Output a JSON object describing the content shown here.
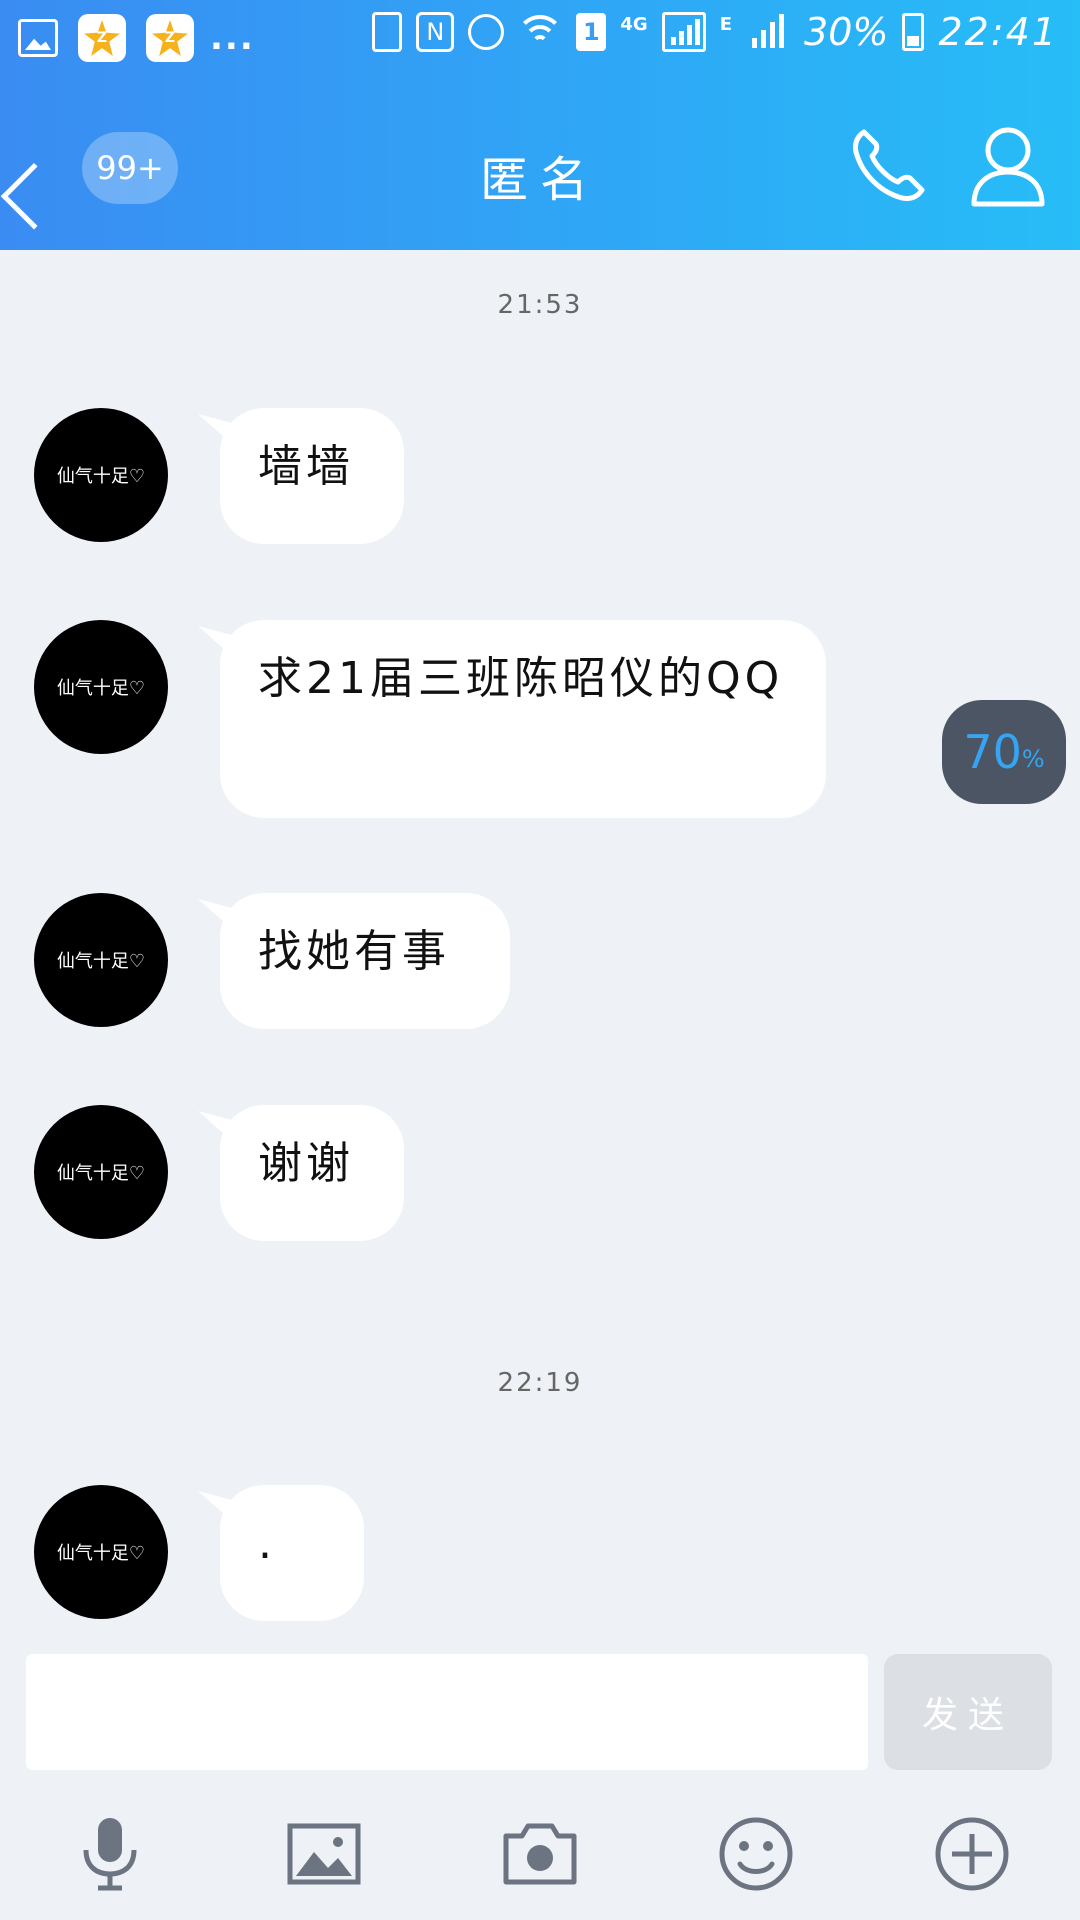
{
  "status_bar": {
    "notif_qzone_label": "Z",
    "more": "...",
    "nfc": "N",
    "sim": "1",
    "network_1": "4G",
    "network_2": "E",
    "battery": "30%",
    "time": "22:41"
  },
  "header": {
    "unread_badge": "99+",
    "title": "匿名",
    "icons": [
      "back-arrow-icon",
      "phone-icon",
      "profile-icon"
    ]
  },
  "messages": [
    {
      "timestamp": "21:53"
    },
    {
      "avatar_text": "仙气十足♡",
      "text": "墙墙"
    },
    {
      "avatar_text": "仙气十足♡",
      "text": "求21届三班陈昭仪的QQ"
    },
    {
      "avatar_text": "仙气十足♡",
      "text": "找她有事"
    },
    {
      "avatar_text": "仙气十足♡",
      "text": "谢谢"
    },
    {
      "timestamp": "22:19"
    },
    {
      "avatar_text": "仙气十足♡",
      "text": "."
    }
  ],
  "progress_overlay": {
    "value": "70",
    "unit": "%"
  },
  "composer": {
    "input_value": "",
    "send_label": "发送"
  },
  "toolbar": {
    "icons": [
      "microphone-icon",
      "image-icon",
      "camera-icon",
      "emoji-icon",
      "plus-icon"
    ]
  },
  "colors": {
    "header_gradient_start": "#3a8cf2",
    "header_gradient_end": "#27bdf7",
    "chat_background": "#eef1f6",
    "toolbar_icon": "#6b7480",
    "progress_text": "#35a4f2"
  }
}
